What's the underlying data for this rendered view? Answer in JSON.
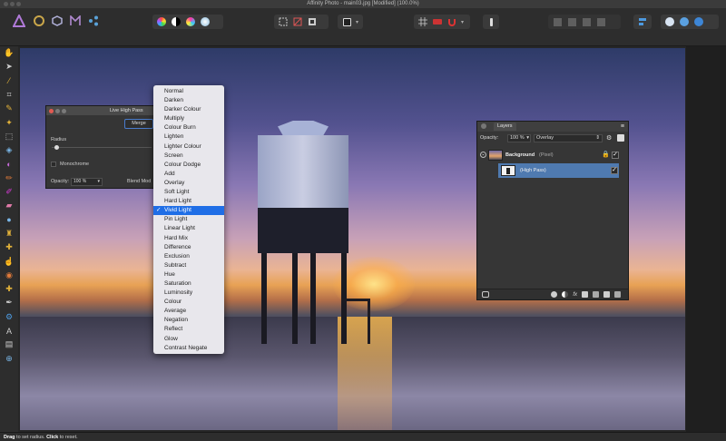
{
  "window": {
    "title": "Affinity Photo - main03.jpg [Modified] (100.0%)"
  },
  "toolbar": {
    "personas": [
      "affinity-photo-persona",
      "liquify-persona",
      "develop-persona",
      "tone-mapping-persona",
      "export-persona"
    ]
  },
  "live_high_pass": {
    "title": "Live High Pass",
    "merge_label": "Merge",
    "radius_label": "Radius",
    "radius_value": 0.05,
    "monochrome_label": "Monochrome",
    "opacity_label": "Opacity:",
    "opacity_value": "100 %",
    "blend_mode_label": "Blend Mod"
  },
  "blend_menu": {
    "selected": "Vivid Light",
    "items": [
      "Normal",
      "Darken",
      "Darker Colour",
      "Multiply",
      "Colour Burn",
      "Lighten",
      "Lighter Colour",
      "Screen",
      "Colour Dodge",
      "Add",
      "Overlay",
      "Soft Light",
      "Hard Light",
      "Vivid Light",
      "Pin Light",
      "Linear Light",
      "Hard Mix",
      "Difference",
      "Exclusion",
      "Subtract",
      "Hue",
      "Saturation",
      "Luminosity",
      "Colour",
      "Average",
      "Negation",
      "Reflect",
      "Glow",
      "Contrast Negate"
    ]
  },
  "layers": {
    "tab_label": "Layers",
    "opacity_label": "Opacity:",
    "opacity_value": "100 %",
    "blend_value": "Overlay",
    "rows": [
      {
        "name": "Background",
        "type": "(Pixel)"
      },
      {
        "name": "(High Pass)"
      }
    ]
  },
  "status": {
    "bold1": "Drag",
    "text1": " to set radius. ",
    "bold2": "Click",
    "text2": " to reset."
  },
  "colors": {
    "accent": "#1f6ee6",
    "merge_border": "#4a7ccc",
    "selected_layer": "#4f7ab0"
  }
}
